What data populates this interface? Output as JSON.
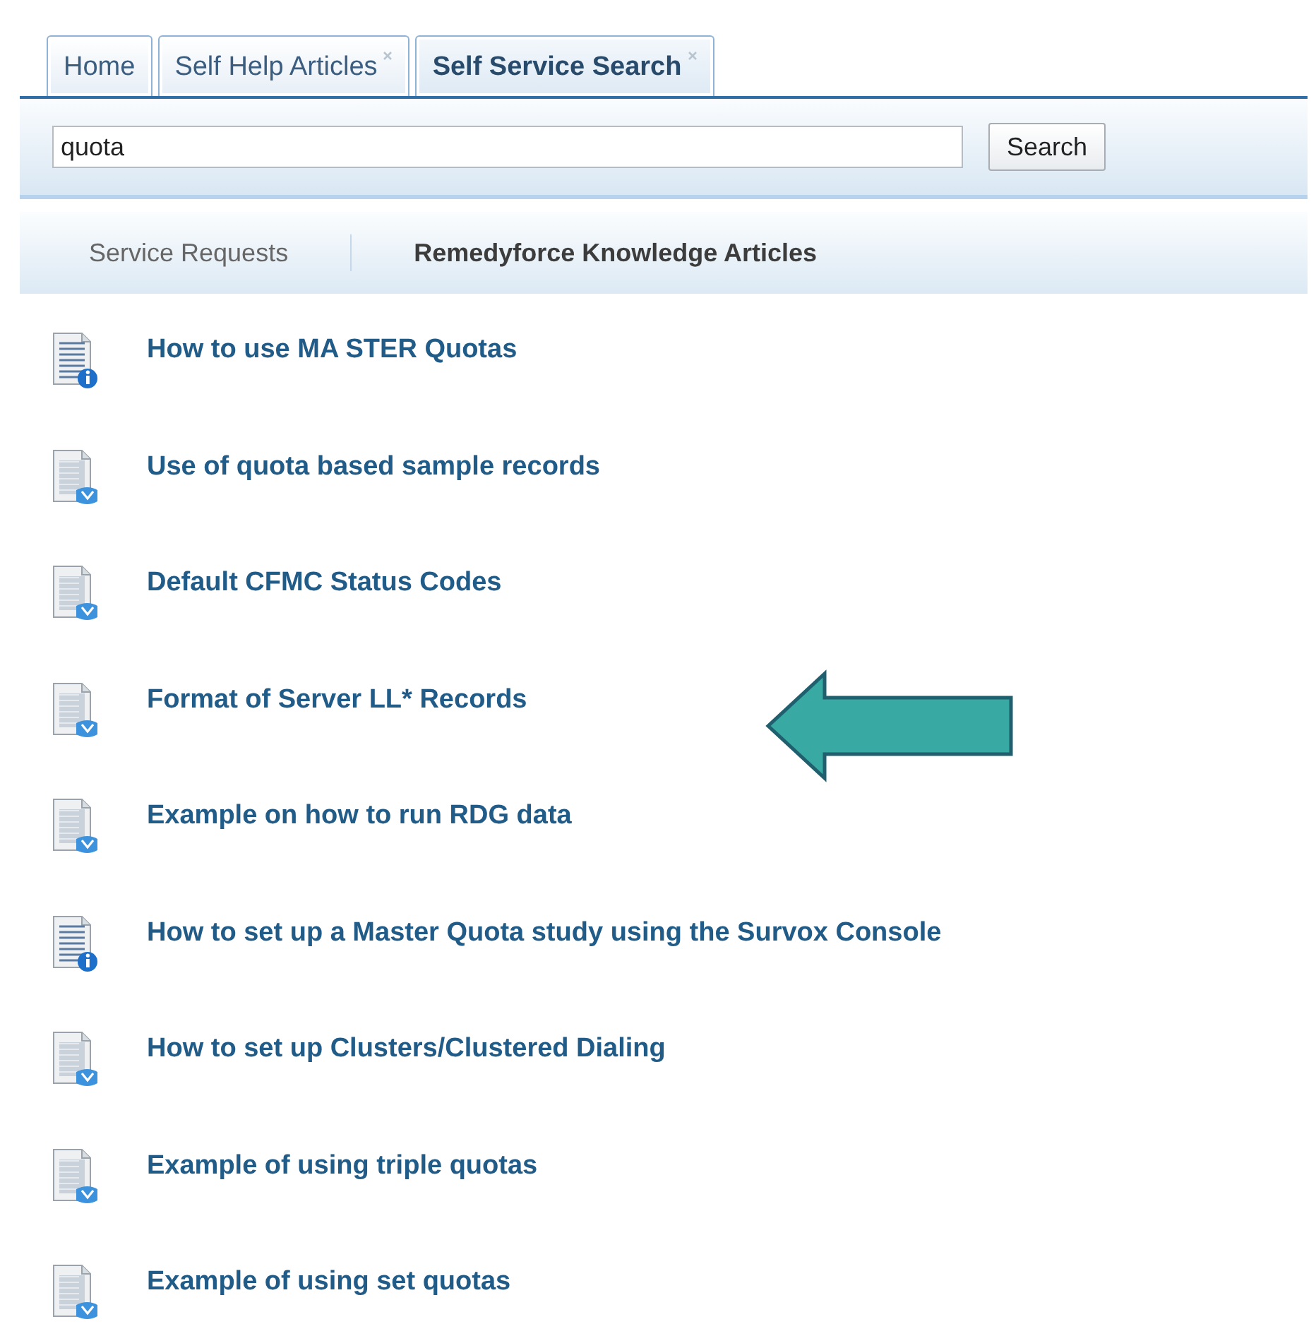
{
  "tabs": [
    {
      "label": "Home",
      "closable": false,
      "selected": false
    },
    {
      "label": "Self Help Articles",
      "closable": true,
      "selected": false
    },
    {
      "label": "Self Service Search",
      "closable": true,
      "selected": true
    }
  ],
  "search": {
    "value": "quota",
    "button": "Search"
  },
  "subtabs": [
    {
      "label": "Service Requests",
      "selected": false
    },
    {
      "label": "Remedyforce Knowledge Articles",
      "selected": true
    }
  ],
  "articles": [
    {
      "title": "How to use MA STER Quotas",
      "kind": "info"
    },
    {
      "title": "Use of quota based sample records",
      "kind": "download"
    },
    {
      "title": "Default CFMC Status Codes",
      "kind": "download"
    },
    {
      "title": "Format of Server LL* Records",
      "kind": "download"
    },
    {
      "title": "Example on  how to run RDG data",
      "kind": "download"
    },
    {
      "title": "How to set up a Master Quota study using the Survox Console",
      "kind": "info"
    },
    {
      "title": "How to set up Clusters/Clustered Dialing",
      "kind": "download"
    },
    {
      "title": "Example of using triple quotas",
      "kind": "download"
    },
    {
      "title": "Example of using set quotas",
      "kind": "download"
    }
  ]
}
